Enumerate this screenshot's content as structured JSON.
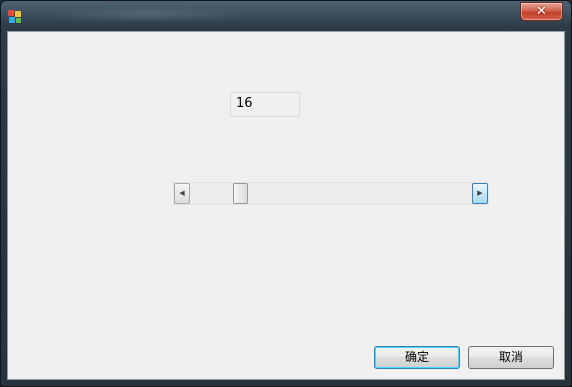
{
  "window": {
    "close_label": "✕"
  },
  "value_display": {
    "value": "16"
  },
  "slider": {
    "value": 16,
    "min": 0,
    "max": 100,
    "left_arrow": "◀",
    "right_arrow": "▶"
  },
  "buttons": {
    "ok_label": "确定",
    "cancel_label": "取消"
  }
}
